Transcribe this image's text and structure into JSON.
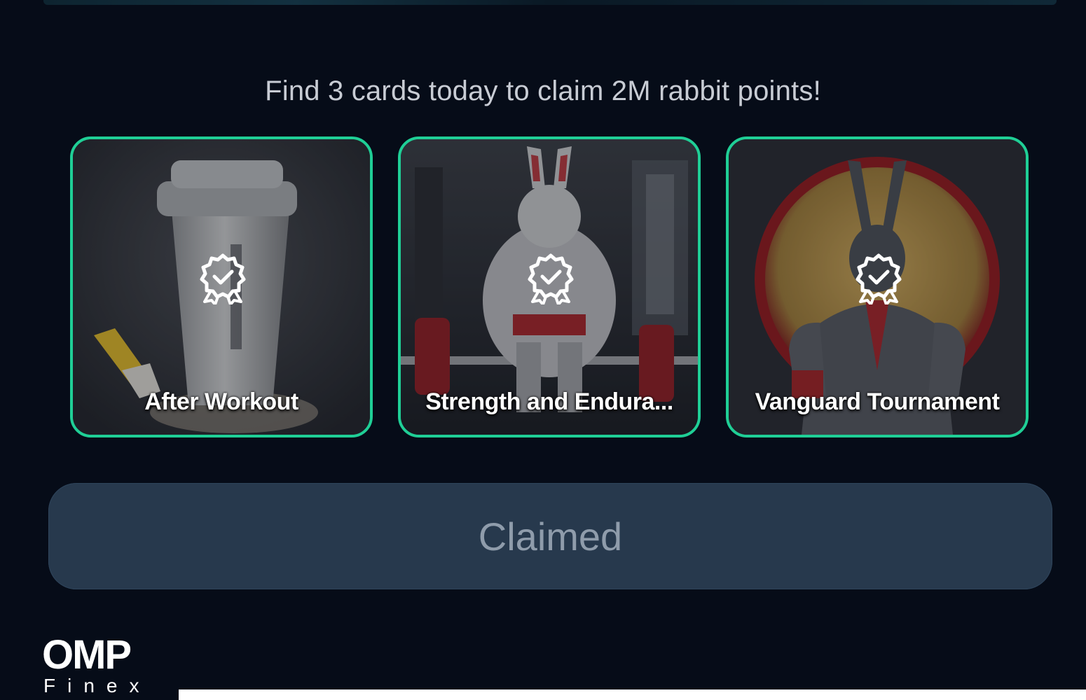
{
  "headline": "Find 3 cards today to claim 2M rabbit points!",
  "cards": [
    {
      "title": "After Workout",
      "status_icon": "award-check-icon"
    },
    {
      "title": "Strength and Endura...",
      "status_icon": "award-check-icon"
    },
    {
      "title": "Vanguard Tournament",
      "status_icon": "award-check-icon"
    }
  ],
  "claim_button": {
    "label": "Claimed",
    "state": "disabled"
  },
  "watermark": {
    "brand": "OMP",
    "sub": "Finex"
  },
  "colors": {
    "background": "#060c18",
    "card_border": "#1fcf96",
    "button_bg": "#27394d",
    "button_text": "#8f9cab",
    "headline_text": "#c8ccd4"
  }
}
